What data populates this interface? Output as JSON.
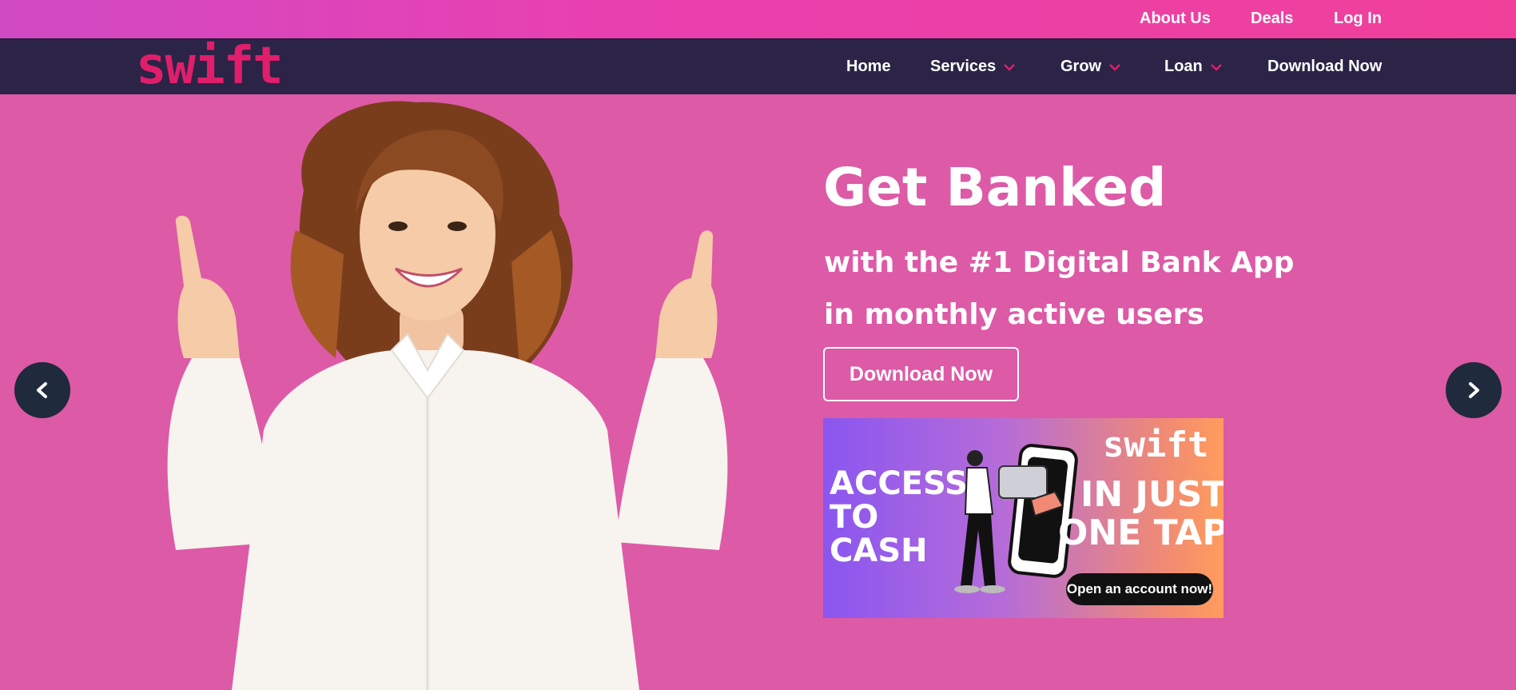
{
  "topbar": {
    "links": [
      "About Us",
      "Deals",
      "Log In"
    ]
  },
  "nav": {
    "logo": "swift",
    "items": [
      {
        "label": "Home",
        "dropdown": false
      },
      {
        "label": "Services",
        "dropdown": true
      },
      {
        "label": "Grow",
        "dropdown": true
      },
      {
        "label": "Loan",
        "dropdown": true
      },
      {
        "label": "Download Now",
        "dropdown": false
      }
    ]
  },
  "hero": {
    "title": "Get Banked",
    "subtitle_line1": "with the #1 Digital Bank App",
    "subtitle_line2": "in monthly active users",
    "cta_label": "Download Now",
    "banner": {
      "brand": "swift",
      "left_text": [
        "ACCESS",
        "TO",
        "CASH"
      ],
      "right_text": [
        "IN JUST",
        "ONE TAP"
      ],
      "button": "Open an account now!"
    }
  },
  "colors": {
    "topbar_start": "#d04ac4",
    "topbar_end": "#f0409a",
    "navbar_bg": "#2b2446",
    "logo": "#e01e6b",
    "hero_bg": "#dd5aa6",
    "arrow_bg": "#1f2a3c",
    "chevron": "#e01e6b"
  },
  "icons": {
    "prev": "chevron-left-icon",
    "next": "chevron-right-icon",
    "dropdown": "chevron-down-icon"
  }
}
